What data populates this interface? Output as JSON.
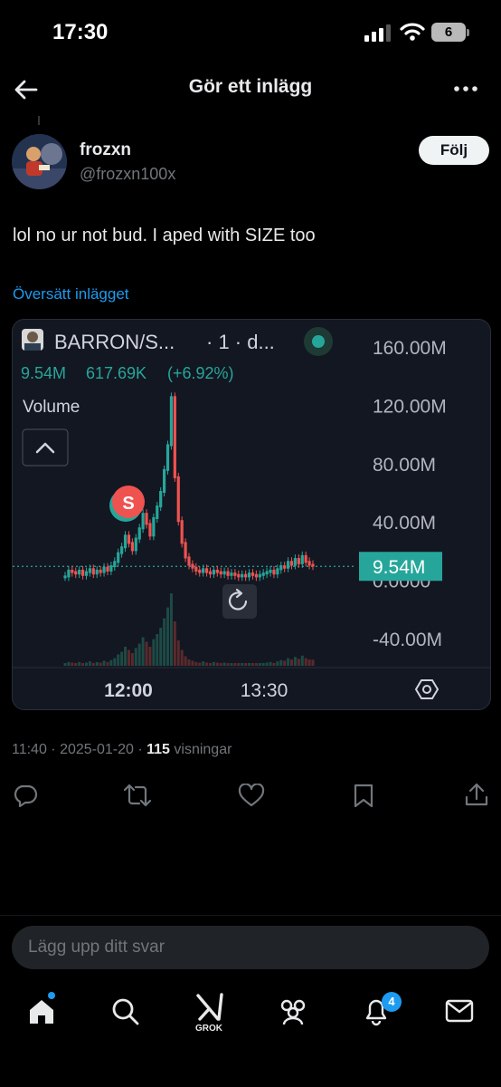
{
  "status_bar": {
    "time": "17:30",
    "battery": "6"
  },
  "header": {
    "title": "Gör ett inlägg",
    "back_icon": "arrow-left-icon",
    "more_icon": "ellipsis-icon"
  },
  "author": {
    "display_name": "frozxn",
    "handle": "@frozxn100x",
    "follow_label": "Följ"
  },
  "tweet": {
    "text": "lol no ur not bud. I aped with SIZE too",
    "translate_label": "Översätt inlägget"
  },
  "chart_card": {
    "symbol": "BARRON/S...",
    "interval": "· 1 · d...",
    "volume_line": {
      "value": "9.54M",
      "change_abs": "617.69K",
      "change_pct": "(+6.92%)"
    },
    "volume_label": "Volume",
    "marker_label": "S",
    "last_price_label": "9.54M",
    "colors": {
      "up": "#26a69a",
      "down": "#ef5350",
      "bg": "#131722"
    }
  },
  "chart_data": {
    "type": "line",
    "title": "BARRON/S...",
    "x_tick_labels": [
      "12:00",
      "13:30"
    ],
    "y_tick_labels": [
      "160.00M",
      "120.00M",
      "80.00M",
      "40.00M",
      "0.0000",
      "-40.00M"
    ],
    "ylim": [
      -40,
      160
    ],
    "ylabel": "",
    "series": [
      {
        "name": "Volume",
        "x_index": [
          0,
          2,
          4,
          6,
          8,
          10,
          12,
          14,
          16,
          18,
          20,
          22,
          24,
          26,
          28,
          30,
          32,
          34,
          36,
          38,
          40,
          42,
          44,
          46,
          48,
          50,
          52,
          54,
          56,
          58,
          60,
          62,
          64,
          66,
          68,
          70,
          72,
          74,
          76,
          78,
          80,
          82,
          84,
          86,
          88,
          90,
          92,
          94,
          96,
          98,
          100,
          102,
          104,
          106,
          108,
          110,
          112,
          114,
          116,
          118,
          120,
          122,
          124,
          126,
          128,
          130,
          132,
          134,
          136,
          138,
          140
        ],
        "values": [
          2,
          6,
          5,
          4,
          6,
          3,
          5,
          7,
          4,
          6,
          5,
          8,
          6,
          9,
          12,
          18,
          22,
          30,
          25,
          20,
          28,
          35,
          45,
          38,
          30,
          42,
          50,
          60,
          75,
          92,
          125,
          70,
          40,
          25,
          15,
          10,
          8,
          6,
          5,
          7,
          5,
          4,
          6,
          5,
          4,
          5,
          3,
          4,
          3,
          2,
          3,
          2,
          4,
          3,
          2,
          3,
          4,
          5,
          6,
          4,
          7,
          9,
          8,
          12,
          10,
          14,
          11,
          16,
          12,
          10,
          9.54
        ]
      }
    ],
    "last_value_label": "9.54M",
    "grid": false
  },
  "footer": {
    "timestamp": "11:40 · 2025-01-20 · ",
    "views_count": "115",
    "views_label": " visningar"
  },
  "actions": [
    {
      "icon": "reply-icon"
    },
    {
      "icon": "repost-icon"
    },
    {
      "icon": "like-icon"
    },
    {
      "icon": "bookmark-icon"
    },
    {
      "icon": "share-icon"
    }
  ],
  "reply_box": {
    "placeholder": "Lägg upp ditt svar"
  },
  "bottom_nav": {
    "grok_label": "GROK",
    "notifications_badge": "4"
  }
}
